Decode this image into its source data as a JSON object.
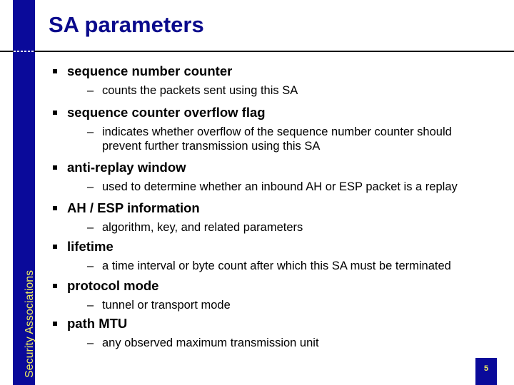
{
  "slide": {
    "title": "SA parameters",
    "sidebar_label": "Security Associations",
    "page_number": "5",
    "colors": {
      "sidebar": "#0a0a9a",
      "sidebar_text": "#f0ee60",
      "title": "#0a0a8c"
    }
  },
  "items": [
    {
      "label": "sequence number counter",
      "sub": [
        "counts the packets sent using this SA"
      ]
    },
    {
      "label": "sequence counter overflow flag",
      "sub": [
        "indicates whether overflow of the sequence number counter should prevent further transmission using this SA"
      ]
    },
    {
      "label": "anti-replay window",
      "sub": [
        "used to determine whether an inbound AH or ESP packet is a replay"
      ]
    },
    {
      "label": "AH / ESP information",
      "sub": [
        "algorithm, key, and related parameters"
      ]
    },
    {
      "label": "lifetime",
      "sub": [
        "a time interval or byte count after which this SA must be terminated"
      ]
    },
    {
      "label": "protocol mode",
      "sub": [
        "tunnel or transport mode"
      ]
    },
    {
      "label": "path MTU",
      "sub": [
        "any observed maximum transmission unit"
      ]
    }
  ],
  "symbols": {
    "bullet": "square-bullet",
    "dash": "–"
  }
}
